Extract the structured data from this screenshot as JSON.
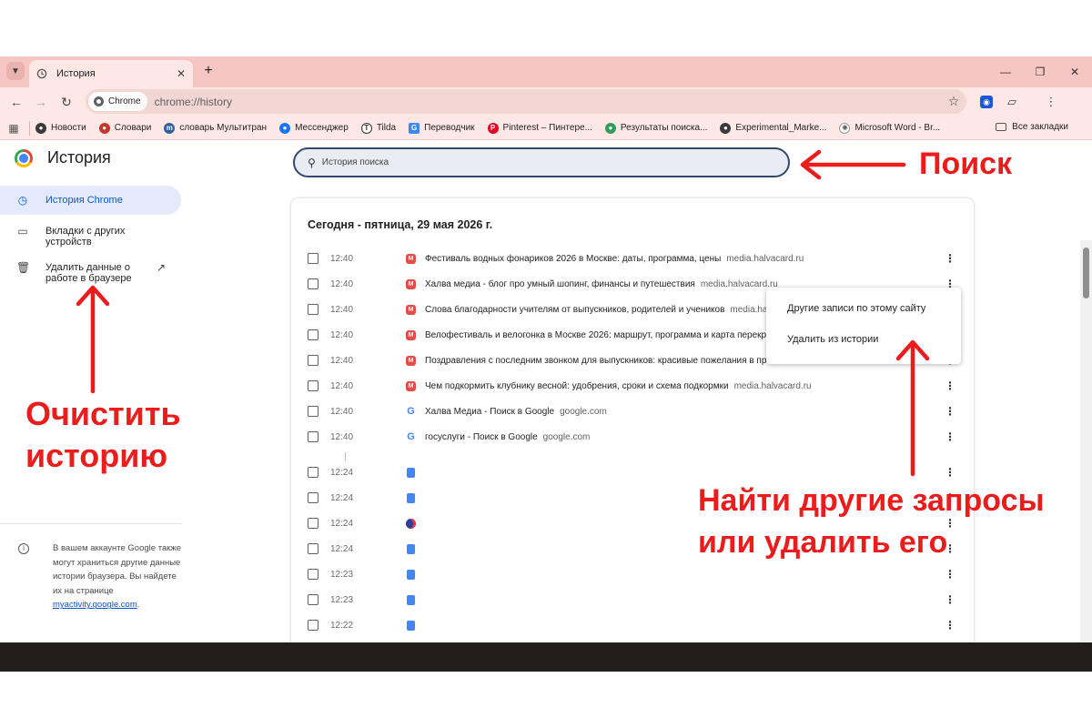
{
  "colors": {
    "accent": "#0b57d0",
    "annotation": "#ea1c1c",
    "frame": "#f5c6c3"
  },
  "tab": {
    "title": "История",
    "icon": "history-icon"
  },
  "toolbar": {
    "chip_label": "Chrome",
    "url": "chrome://history"
  },
  "bookmarks": {
    "items": [
      {
        "label": "Новости",
        "icon": "globe-icon"
      },
      {
        "label": "Словари",
        "icon": "dictionary-icon"
      },
      {
        "label": "словарь Мультитран",
        "icon": "multitran-icon"
      },
      {
        "label": "Мессенджер",
        "icon": "messenger-icon"
      },
      {
        "label": "Tilda",
        "icon": "tilda-icon"
      },
      {
        "label": "Переводчик",
        "icon": "translate-icon"
      },
      {
        "label": "Pinterest – Пинтере...",
        "icon": "pinterest-icon"
      },
      {
        "label": "Результаты поиска...",
        "icon": "search-results-icon"
      },
      {
        "label": "Experimental_Marke...",
        "icon": "globe-icon"
      },
      {
        "label": "Microsoft Word - Br...",
        "icon": "word-icon"
      }
    ],
    "all_label": "Все закладки"
  },
  "page": {
    "title": "История",
    "search_placeholder": "История поиска"
  },
  "sidebar": {
    "items": [
      {
        "label": "История Chrome",
        "icon": "history-icon"
      },
      {
        "label": "Вкладки с других устройств",
        "icon": "devices-icon"
      },
      {
        "label": "Удалить данные о работе в браузере",
        "icon": "trash-icon"
      }
    ],
    "note": "В вашем аккаунте Google также могут храниться другие данные истории браузера. Вы найдете их на странице",
    "note_link": "myactivity.google.com",
    "note_end": "."
  },
  "history": {
    "date_heading": "Сегодня - пятница, 29 мая 2026 г.",
    "rows": [
      {
        "time": "12:40",
        "icon": "halvacard-icon",
        "title": "Фестиваль водных фонариков 2026 в Москве: даты, программа, цены",
        "domain": "media.halvacard.ru"
      },
      {
        "time": "12:40",
        "icon": "halvacard-icon",
        "title": "Халва медиа - блог про умный шопинг, финансы и путешествия",
        "domain": "media.halvacard.ru"
      },
      {
        "time": "12:40",
        "icon": "halvacard-icon",
        "title": "Слова благодарности учителям от выпускников, родителей и учеников",
        "domain": "media.halva"
      },
      {
        "time": "12:40",
        "icon": "halvacard-icon",
        "title": "Велофестиваль и велогонка в Москве 2026: маршрут, программа и карта перекрыти",
        "domain": ""
      },
      {
        "time": "12:40",
        "icon": "halvacard-icon",
        "title": "Поздравления с последним звонком для выпускников: красивые пожелания в проз",
        "domain": ""
      },
      {
        "time": "12:40",
        "icon": "halvacard-icon",
        "title": "Чем подкормить клубнику весной: удобрения, сроки и схема подкормки",
        "domain": "media.halvacard.ru"
      },
      {
        "time": "12:40",
        "icon": "google-icon",
        "title": "Халва Медиа - Поиск в Google",
        "domain": "google.com"
      },
      {
        "time": "12:40",
        "icon": "google-icon",
        "title": "госуслуги - Поиск в Google",
        "domain": "google.com"
      },
      {
        "time": "12:24",
        "icon": "docs-icon",
        "title": "",
        "domain": ""
      },
      {
        "time": "12:24",
        "icon": "docs-icon",
        "title": "",
        "domain": ""
      },
      {
        "time": "12:24",
        "icon": "site-circle-icon",
        "title": "",
        "domain": ""
      },
      {
        "time": "12:24",
        "icon": "docs-icon",
        "title": "",
        "domain": ""
      },
      {
        "time": "12:23",
        "icon": "docs-icon",
        "title": "",
        "domain": ""
      },
      {
        "time": "12:23",
        "icon": "docs-icon",
        "title": "",
        "domain": ""
      },
      {
        "time": "12:22",
        "icon": "docs-icon",
        "title": "",
        "domain": ""
      }
    ]
  },
  "context_menu": {
    "items": [
      "Другие записи по этому сайту",
      "Удалить из истории"
    ]
  },
  "annotations": {
    "search": "Поиск",
    "clear_line1": "Очистить",
    "clear_line2": "историю",
    "find_line1": "Найти другие запросы",
    "find_line2": "или удалить его"
  }
}
